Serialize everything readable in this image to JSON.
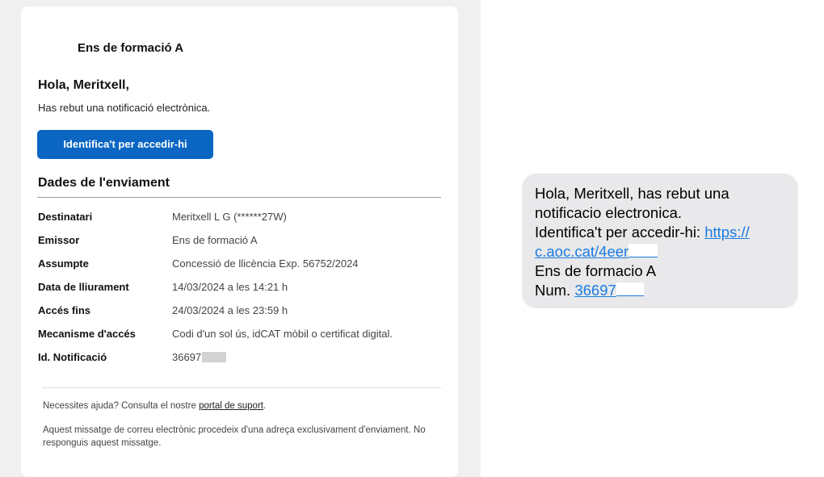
{
  "email": {
    "sender_name": "Ens de formació A",
    "greeting": "Hola, Meritxell,",
    "intro": "Has rebut una notificació electrònica.",
    "cta_label": "Identifica't per accedir-hi",
    "section_title": "Dades de l'enviament",
    "details": [
      {
        "label": "Destinatari",
        "value": "Meritxell L G (******27W)"
      },
      {
        "label": "Emissor",
        "value": "Ens de formació A"
      },
      {
        "label": "Assumpte",
        "value": "Concessió de llicència Exp. 56752/2024"
      },
      {
        "label": "Data de lliurament",
        "value": "14/03/2024 a les 14:21 h"
      },
      {
        "label": "Accés fins",
        "value": "24/03/2024 a les 23:59 h"
      },
      {
        "label": "Mecanisme d'accés",
        "value": "Codi d'un sol ús, idCAT mòbil o certificat digital."
      },
      {
        "label": "Id. Notificació",
        "value": "36697"
      }
    ],
    "help_prefix": "Necessites ajuda? Consulta el nostre",
    "help_link": "portal de suport",
    "help_suffix": ".",
    "disclaimer": "Aquest missatge de correu electrònic procedeix d'una adreça exclusivament d'enviament. No responguis aquest missatge."
  },
  "sms": {
    "line1": "Hola, Meritxell, has rebut una",
    "line2": "notificacio electronica.",
    "line3_prefix": "Identifica't per accedir-hi:",
    "link_part1": "https://",
    "link_part2": "c.aoc.cat/4eer",
    "line5": "Ens de formacio A",
    "line6_prefix": "Num.",
    "num_link": "36697"
  },
  "colors": {
    "button_blue": "#0a66c2",
    "link_blue": "#1a7be0",
    "bubble_gray": "#e9e9eb"
  }
}
